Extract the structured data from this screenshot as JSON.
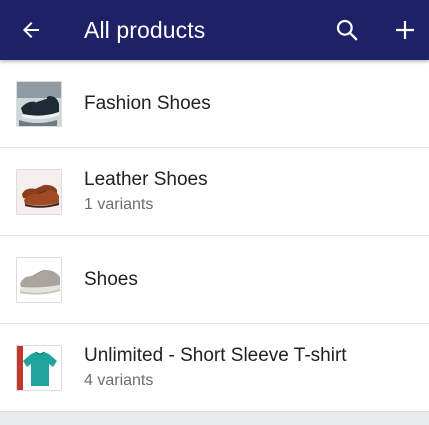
{
  "appbar": {
    "title": "All products",
    "background": "#1f2166",
    "icons": {
      "back": "arrow-back-icon",
      "search": "search-icon",
      "add": "add-icon"
    }
  },
  "products": [
    {
      "name": "Fashion Shoes",
      "variants": "",
      "thumbnail": "sneaker-image"
    },
    {
      "name": "Leather Shoes",
      "variants": "1 variants",
      "thumbnail": "brown-leather-shoe-image"
    },
    {
      "name": "Shoes",
      "variants": "",
      "thumbnail": "grey-shoe-image"
    },
    {
      "name": "Unlimited - Short Sleeve T-shirt",
      "variants": "4 variants",
      "thumbnail": "teal-tshirt-image"
    }
  ]
}
